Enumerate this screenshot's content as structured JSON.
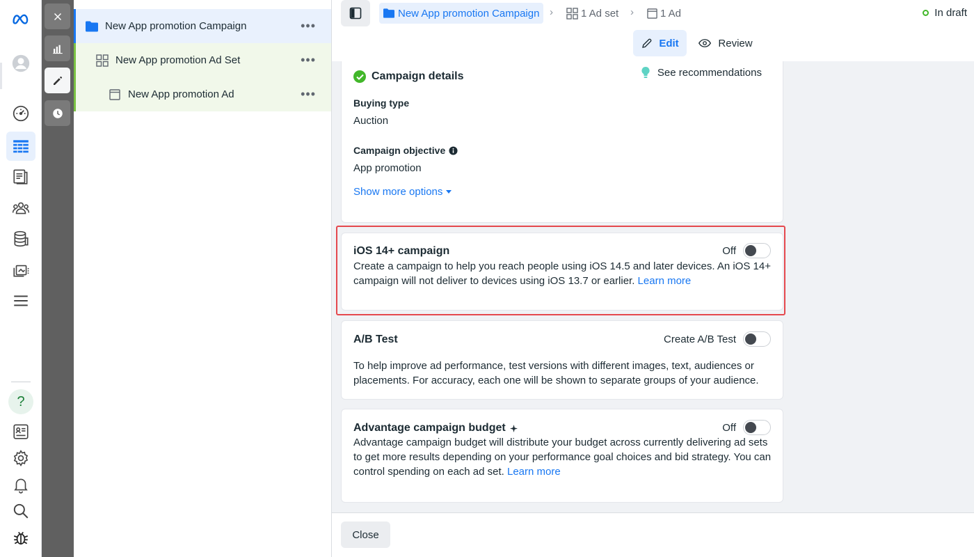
{
  "tree": {
    "campaign": "New App promotion Campaign",
    "adset": "New App promotion Ad Set",
    "ad": "New App promotion Ad"
  },
  "breadcrumb": {
    "campaign": "New App promotion Campaign",
    "adset": "1 Ad set",
    "ad": "1 Ad"
  },
  "status": "In draft",
  "modes": {
    "edit": "Edit",
    "review": "Review"
  },
  "campaign_details": {
    "title": "Campaign details",
    "recommendations": "See recommendations",
    "buying_type_label": "Buying type",
    "buying_type_value": "Auction",
    "objective_label": "Campaign objective",
    "objective_value": "App promotion",
    "show_more": "Show more options"
  },
  "ios": {
    "title": "iOS 14+ campaign",
    "toggle_label": "Off",
    "text": "Create a campaign to help you reach people using iOS 14.5 and later devices. An iOS 14+ campaign will not deliver to devices using iOS 13.7 or earlier.",
    "link": "Learn more"
  },
  "ab_test": {
    "title": "A/B Test",
    "toggle_label": "Create A/B Test",
    "text": "To help improve ad performance, test versions with different images, text, audiences or placements. For accuracy, each one will be shown to separate groups of your audience."
  },
  "advantage": {
    "title": "Advantage campaign budget",
    "toggle_label": "Off",
    "text": "Advantage campaign budget will distribute your budget across currently delivering ad sets to get more results depending on your performance goal choices and bid strategy. You can control spending on each ad set.",
    "link": "Learn more"
  },
  "footer": {
    "close": "Close"
  },
  "colors": {
    "accent": "#1877f2",
    "highlight": "#e5484d",
    "success": "#42b72a"
  }
}
